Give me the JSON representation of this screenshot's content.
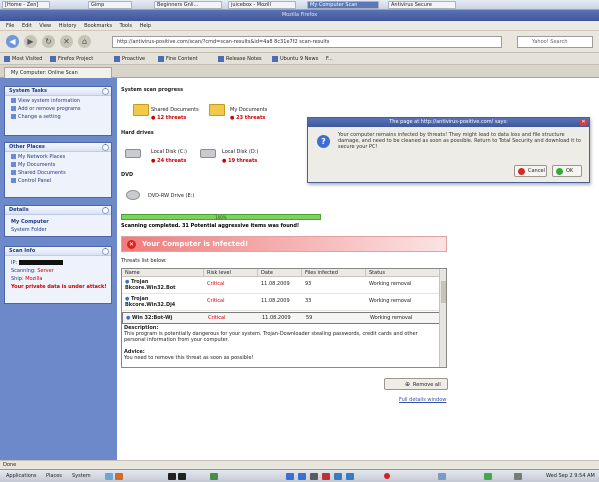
{
  "top_tabs": [
    "[Home - Zen]",
    "Gimp",
    "Beginners Gnli...",
    "juicebox - Mozill",
    "My Computer Scan",
    "Antivirus Secure"
  ],
  "window_title": "Mozilla Firefox",
  "menu": [
    "File",
    "Edit",
    "View",
    "History",
    "Bookmarks",
    "Tools",
    "Help"
  ],
  "nav": {
    "url": "http://antivirus-positive.com/scan/?cmd=scan-results&id=4a8 8c31e7f2 scan-results",
    "search_placeholder": "Yahoo! Search"
  },
  "bookmarks": [
    "Most Visited",
    "Firefox Project",
    "Proactive",
    "Fine Content",
    "Release Notes",
    "Ubuntu 9 News",
    "F..."
  ],
  "tab_label": "My Computer: Online Scan",
  "sidebar": {
    "system_tasks": {
      "title": "System Tasks",
      "items": [
        "View system information",
        "Add or remove programs",
        "Change a setting"
      ]
    },
    "other_places": {
      "title": "Other Places",
      "items": [
        "My Network Places",
        "My Documents",
        "Shared Documents",
        "Control Panel"
      ]
    },
    "details": {
      "title": "Details",
      "line1": "My Computer",
      "line2": "System Folder"
    },
    "scan_info": {
      "title": "Scan Info",
      "l1": "IP: ",
      "l2_label": "Scanning: ",
      "l2_value": "Server",
      "l3_label": "Ship: ",
      "l3_value": "Mozilla",
      "l4": "Your private data is under attack!"
    }
  },
  "main": {
    "system_scan_title": "System scan progress",
    "folders": [
      {
        "name": "Shared Documents",
        "threats": "12 threats"
      },
      {
        "name": "My Documents",
        "threats": "23 threats"
      }
    ],
    "hard_drives_title": "Hard drives",
    "drives": [
      {
        "name": "Local Disk (C:)",
        "threats": "24 threats"
      },
      {
        "name": "Local Disk (D:)",
        "threats": "19 threats"
      }
    ],
    "dvd_title": "DVD",
    "dvd_name": "DVD-RW Drive (E:)",
    "progress_text": "100%",
    "scanning_text": "Scanning completed. 31 Potential aggressive items was found!",
    "infected_text": "Your Computer is Infected!",
    "threats_label": "Threats list below:",
    "table_headers": [
      "Name",
      "Risk level",
      "Date",
      "Files infected",
      "Status"
    ],
    "rows": [
      {
        "name1": "Trojan",
        "name2": "Bkcore.Win32.Bot",
        "risk": "Critical",
        "date": "11.08.2009",
        "files": "93",
        "status": "Working removal"
      },
      {
        "name1": "Trojan",
        "name2": "Bkcore.Win32.Dj4",
        "risk": "Critical",
        "date": "11.08.2009",
        "files": "33",
        "status": "Working removal"
      },
      {
        "name1": "Win 32:Bot-Wj",
        "name2": "",
        "risk": "Critical",
        "date": "11.08.2009",
        "files": "59",
        "status": "Working removal"
      }
    ],
    "description_title": "Description:",
    "description_text": "This program is potentially dangerous for your system. Trojan-Downloader stealing passwords, credit cards and other personal information from your computer.",
    "advice_title": "Advice:",
    "advice_text": "You need to remove this threat as soon as possible!",
    "remove_label": "Remove all",
    "full_link": "Full details window"
  },
  "dialog": {
    "title": "The page at http://antivirus-positive.com/ says:",
    "message": "Your computer remains infected by threats! They might lead to data loss and file structure damage, and need to be cleaned as soon as possible. Return to Total Security and download it to secure your PC!",
    "cancel": "Cancel",
    "ok": "OK"
  },
  "status_text": "Done",
  "taskbar": {
    "menus": [
      "Applications",
      "Places",
      "System"
    ],
    "clock": "Wed Sep 2  9:54 AM"
  },
  "colors": {
    "sidebar_bg": "#6e89c9",
    "threat_red": "#cc0000",
    "progress_green": "#7cd162"
  }
}
